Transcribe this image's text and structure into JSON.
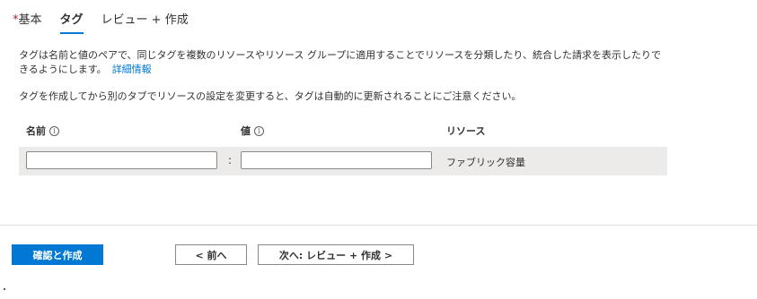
{
  "tabs": [
    {
      "required": "*",
      "label": "基本"
    },
    {
      "label": "タグ"
    },
    {
      "label": "レビュー + 作成"
    }
  ],
  "description": {
    "text": "タグは名前と値のペアで、同じタグを複数のリソースやリソース グループに適用することでリソースを分類したり、統合した請求を表示したりできるようにします。",
    "link": "詳細情報"
  },
  "note": "タグを作成してから別のタブでリソースの設定を変更すると、タグは自動的に更新されることにご注意ください。",
  "table": {
    "headers": {
      "name": "名前",
      "value": "値",
      "resource": "リソース"
    },
    "info_glyph": "i",
    "rows": [
      {
        "name": "",
        "separator": ":",
        "value": "",
        "resource": "ファブリック容量"
      }
    ]
  },
  "footer": {
    "review_create": "確認と作成",
    "prev": "< 前へ",
    "next": "次へ: レビュー + 作成 >"
  },
  "colors": {
    "accent": "#0078d4",
    "required": "#a4262c",
    "row_bg": "#edebe9"
  }
}
